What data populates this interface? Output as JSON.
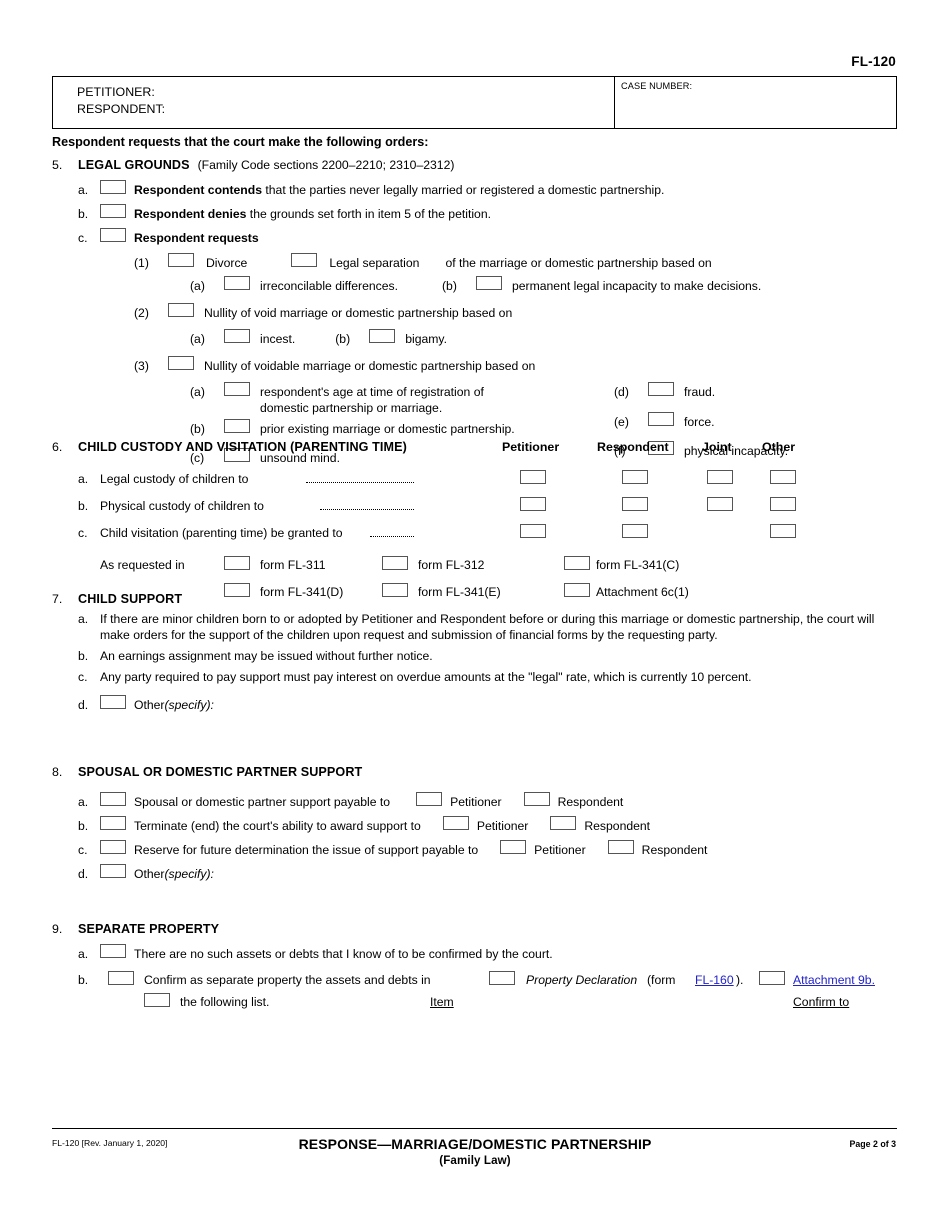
{
  "form_number": "FL-120",
  "caption": {
    "petitioner_label": "PETITIONER:",
    "respondent_label": "RESPONDENT:",
    "case_number_label": "CASE NUMBER:"
  },
  "intro": "Respondent requests that the court make the following orders:",
  "colors": {
    "link": "#2222cc",
    "text": "#000000",
    "checkbox_border": "#555555"
  },
  "section5": {
    "num": "5.",
    "title": "LEGAL GROUNDS",
    "title_sub": "(Family Code sections 2200–2210; 2310–2312)",
    "a": {
      "mark": "a.",
      "bold": "Respondent contends",
      "rest": " that the parties never legally married or registered a domestic partnership."
    },
    "b": {
      "mark": "b.",
      "bold": "Respondent denies",
      "rest": " the grounds set forth in item 5 of the petition."
    },
    "c": {
      "mark": "c.",
      "bold": "Respondent requests"
    },
    "c1": {
      "mark": "(1)",
      "opt1": "Divorce",
      "opt2": "Legal separation",
      "tail": "of the marriage or domestic partnership based on",
      "a": {
        "mark": "(a)",
        "label": "irreconcilable differences."
      },
      "b": {
        "mark": "(b)",
        "label": "permanent legal incapacity to make decisions."
      }
    },
    "c2": {
      "mark": "(2)",
      "label": "Nullity of void marriage or domestic partnership based on",
      "a": {
        "mark": "(a)",
        "label": "incest."
      },
      "b": {
        "mark": "(b)",
        "label": "bigamy."
      }
    },
    "c3": {
      "mark": "(3)",
      "label": "Nullity of voidable marriage or domestic partnership based on",
      "a": {
        "mark": "(a)",
        "label_line1": "respondent's age at time of registration of",
        "label_line2": "domestic partnership or marriage."
      },
      "b": {
        "mark": "(b)",
        "label": "prior existing marriage or domestic partnership."
      },
      "c": {
        "mark": "(c)",
        "label": "unsound mind."
      },
      "d": {
        "mark": "(d)",
        "label": "fraud."
      },
      "e": {
        "mark": "(e)",
        "label": "force."
      },
      "f": {
        "mark": "(f)",
        "label": "physical incapacity."
      }
    }
  },
  "section6": {
    "num": "6.",
    "title": "CHILD CUSTODY AND VISITATION (PARENTING TIME)",
    "columns": [
      "Petitioner",
      "Respondent",
      "Joint",
      "Other"
    ],
    "rows": [
      {
        "mark": "a.",
        "label": "Legal custody of children to",
        "boxes": [
          "Petitioner",
          "Respondent",
          "Joint",
          "Other"
        ]
      },
      {
        "mark": "b.",
        "label": "Physical custody of children to",
        "boxes": [
          "Petitioner",
          "Respondent",
          "Joint",
          "Other"
        ]
      },
      {
        "mark": "c.",
        "label": "Child visitation (parenting time) be granted to",
        "boxes": [
          "Petitioner",
          "Respondent",
          "Other"
        ]
      }
    ],
    "as_requested_label": "As requested in",
    "as_requested_options": [
      [
        "form FL-311",
        "form FL-312",
        "form FL-341(C)"
      ],
      [
        "form FL-341(D)",
        "form FL-341(E)",
        "Attachment 6c(1)"
      ]
    ]
  },
  "section7": {
    "num": "7.",
    "title": "CHILD SUPPORT",
    "a": {
      "mark": "a.",
      "text": "If there are minor children born to or adopted by Petitioner and Respondent before or during this marriage or domestic partnership, the court will make orders for the support of the children upon request and submission of financial forms by the requesting party."
    },
    "b": {
      "mark": "b.",
      "text": "An earnings assignment may be issued without further notice."
    },
    "c": {
      "mark": "c.",
      "text": "Any party required to pay support must pay interest on overdue amounts at the \"legal\" rate, which is currently 10 percent."
    },
    "d": {
      "mark": "d.",
      "text": "Other ",
      "specify": "(specify):"
    }
  },
  "section8": {
    "num": "8.",
    "title": "SPOUSAL OR DOMESTIC PARTNER SUPPORT",
    "a": {
      "mark": "a.",
      "text": "Spousal or domestic partner support payable to",
      "opt1": "Petitioner",
      "opt2": "Respondent"
    },
    "b": {
      "mark": "b.",
      "text": "Terminate (end) the court's ability to award support to",
      "opt1": "Petitioner",
      "opt2": "Respondent"
    },
    "c": {
      "mark": "c.",
      "text": "Reserve for future determination the issue of support payable to",
      "opt1": "Petitioner",
      "opt2": "Respondent"
    },
    "d": {
      "mark": "d.",
      "text": "Other ",
      "specify": "(specify):"
    }
  },
  "section9": {
    "num": "9.",
    "title": "SEPARATE PROPERTY",
    "a": {
      "mark": "a.",
      "text": "There are no such assets or debts that I know of to be confirmed by the court."
    },
    "b": {
      "mark": "b.",
      "text": "Confirm as separate property the assets and debts in",
      "prop_decl": "Property Declaration",
      "form_prefix": "(form ",
      "form_link": "FL-160",
      "form_suffix": ").",
      "attachment_link": "Attachment 9b.",
      "following_list": "the following list.",
      "item_label": "Item",
      "confirm_to_label": "Confirm to"
    }
  },
  "footer": {
    "left": "FL-120 [Rev. January 1, 2020]",
    "title": "RESPONSE—MARRIAGE/DOMESTIC PARTNERSHIP",
    "subtitle": "(Family Law)",
    "page": "Page 2 of  3"
  }
}
